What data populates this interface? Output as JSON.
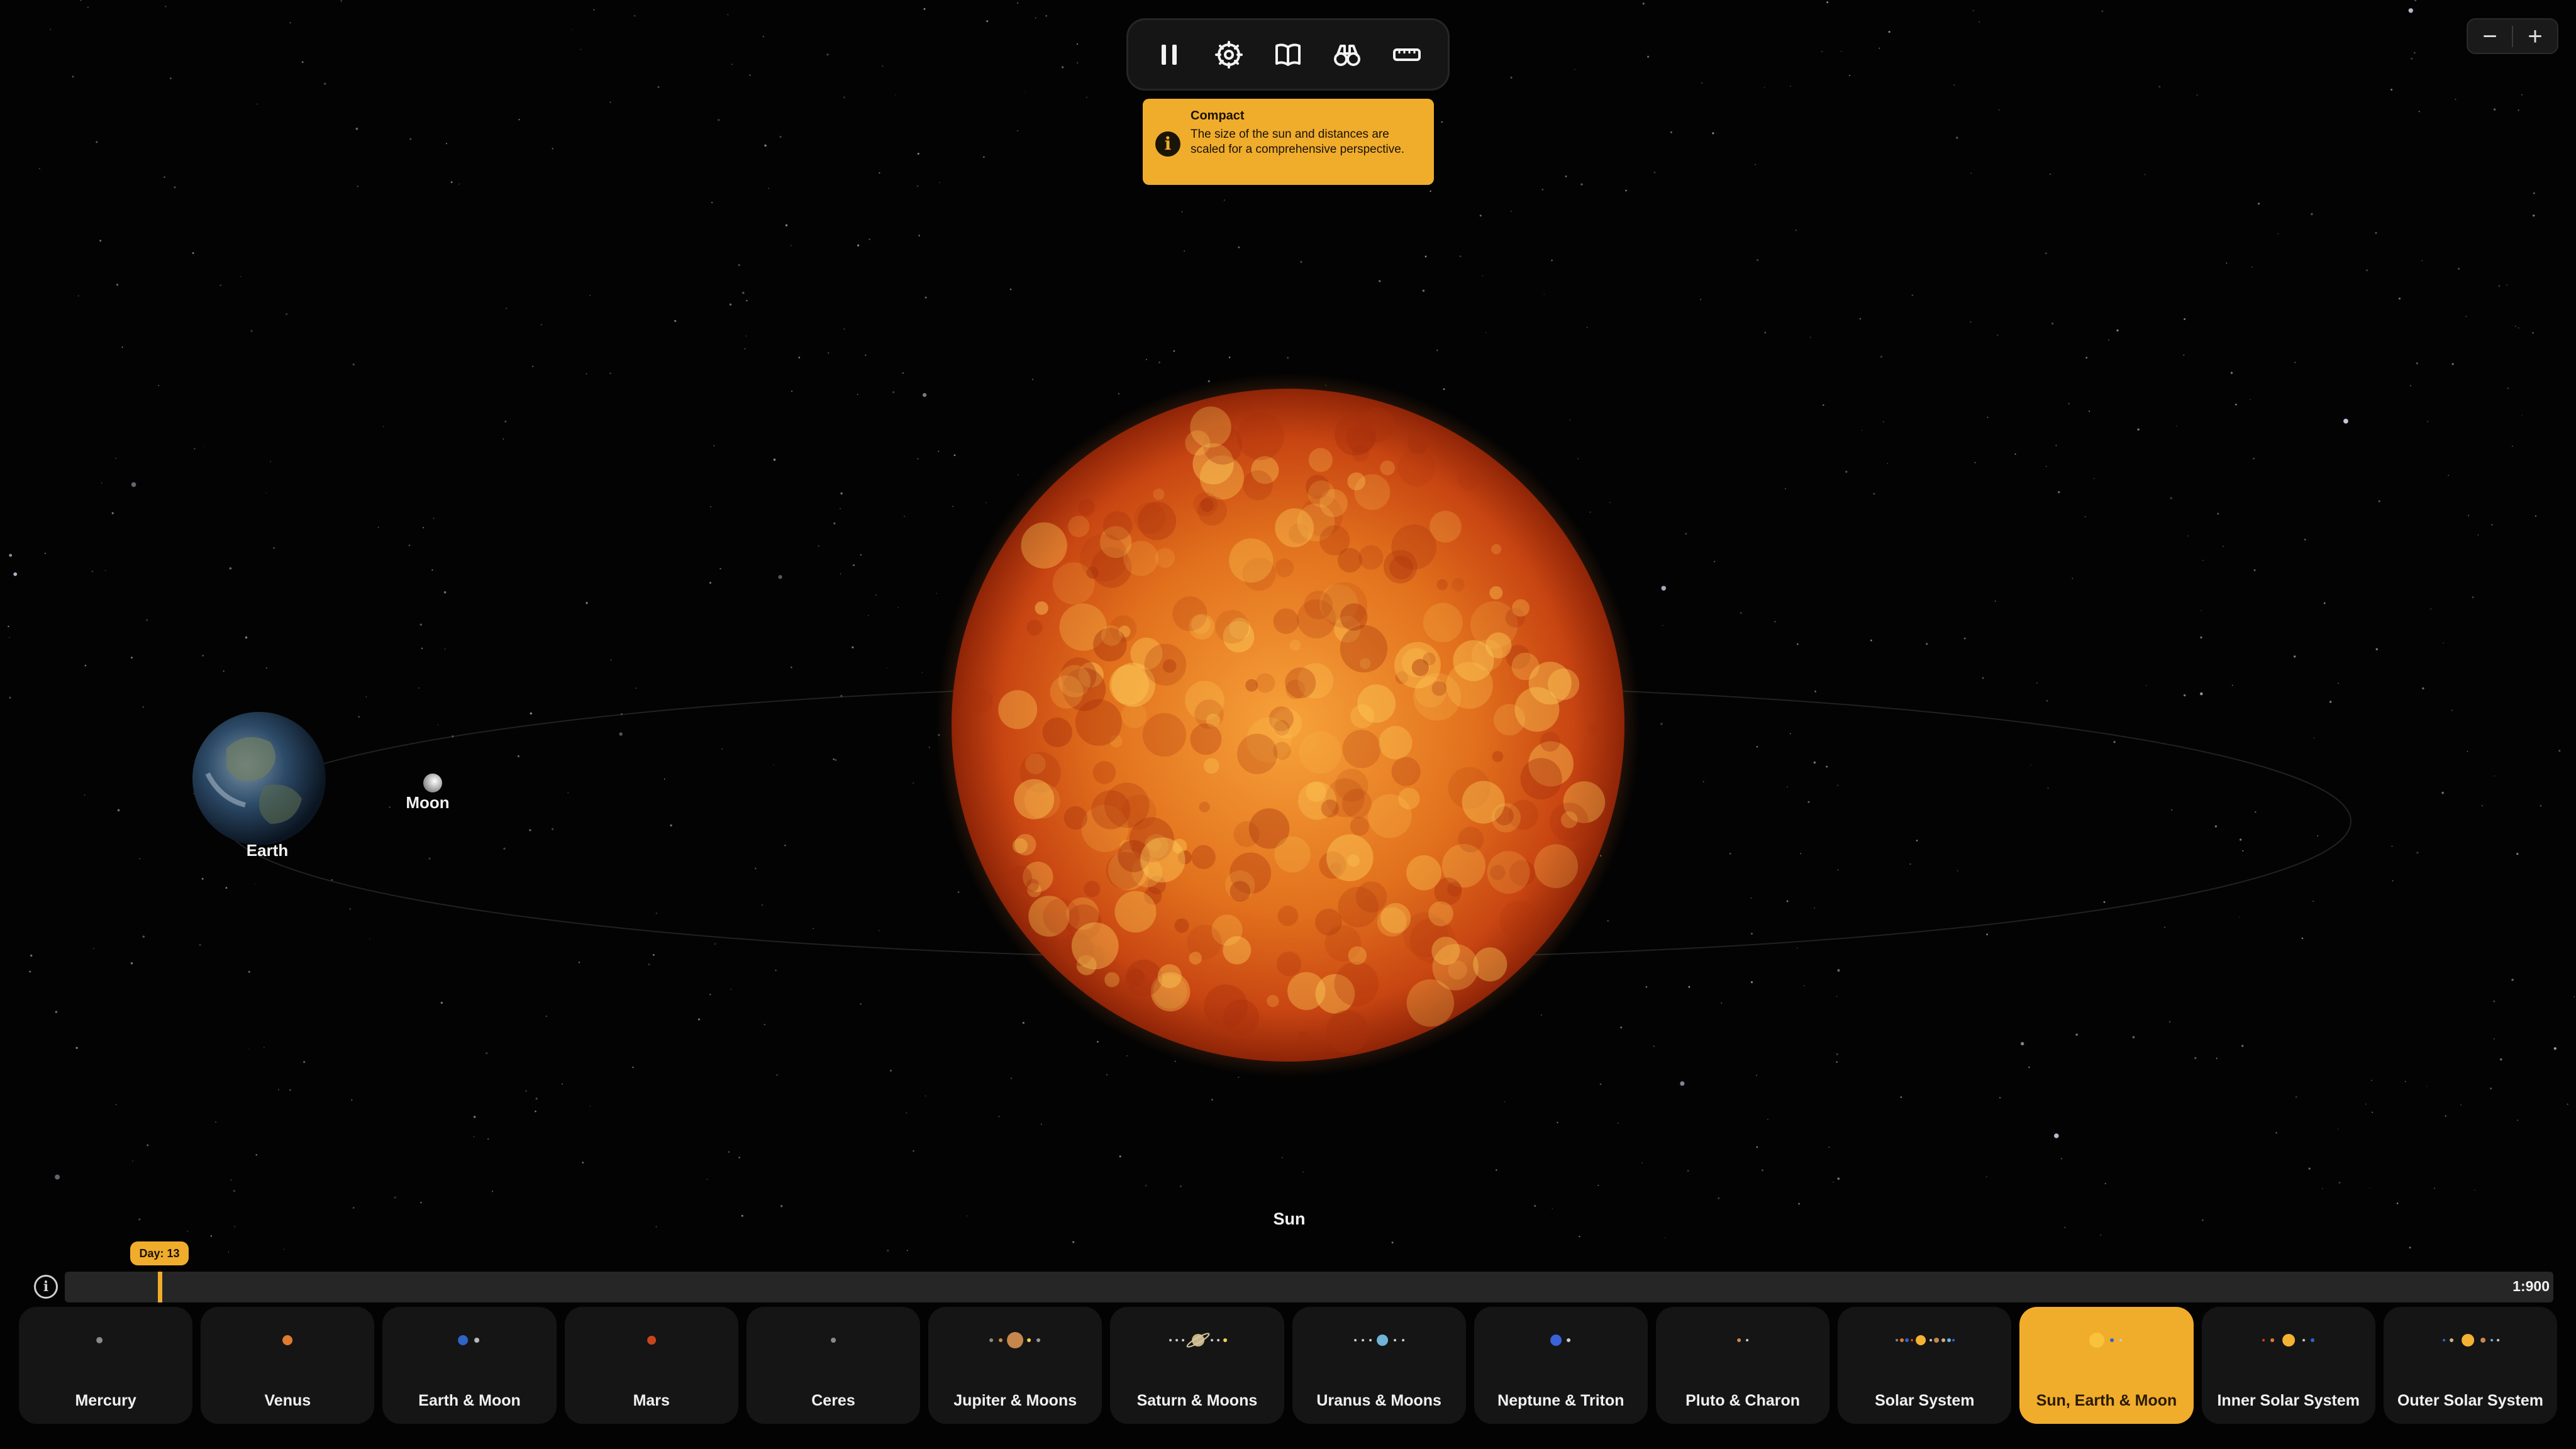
{
  "toolbar": {
    "buttons": [
      {
        "name": "pause",
        "icon": "pause-icon"
      },
      {
        "name": "settings",
        "icon": "gear-icon"
      },
      {
        "name": "learn",
        "icon": "book-icon"
      },
      {
        "name": "observe",
        "icon": "binoculars-icon"
      },
      {
        "name": "ruler",
        "icon": "ruler-icon"
      }
    ]
  },
  "zoom": {
    "minus": "−",
    "plus": "+"
  },
  "tooltip": {
    "icon": "info-icon",
    "title": "Compact",
    "body": "The size of the sun and distances are scaled for a comprehensive perspective."
  },
  "scene": {
    "labels": {
      "earth": "Earth",
      "moon": "Moon",
      "sun": "Sun"
    }
  },
  "timeline": {
    "day_label": "Day: 13",
    "scale": "1:900",
    "info_icon": "info-icon",
    "progress": 0.028
  },
  "presets": [
    {
      "label": "Mercury",
      "active": false
    },
    {
      "label": "Venus",
      "active": false
    },
    {
      "label": "Earth & Moon",
      "active": false
    },
    {
      "label": "Mars",
      "active": false
    },
    {
      "label": "Ceres",
      "active": false
    },
    {
      "label": "Jupiter & Moons",
      "active": false
    },
    {
      "label": "Saturn & Moons",
      "active": false
    },
    {
      "label": "Uranus & Moons",
      "active": false
    },
    {
      "label": "Neptune & Triton",
      "active": false
    },
    {
      "label": "Pluto & Charon",
      "active": false
    },
    {
      "label": "Solar System",
      "active": false
    },
    {
      "label": "Sun, Earth & Moon",
      "active": true
    },
    {
      "label": "Inner Solar System",
      "active": false
    },
    {
      "label": "Outer Solar System",
      "active": false
    }
  ],
  "colors": {
    "accent": "#f0ad2c",
    "sun_core": "#f7a23a",
    "sun_edge": "#b8330e",
    "background": "#000000"
  }
}
